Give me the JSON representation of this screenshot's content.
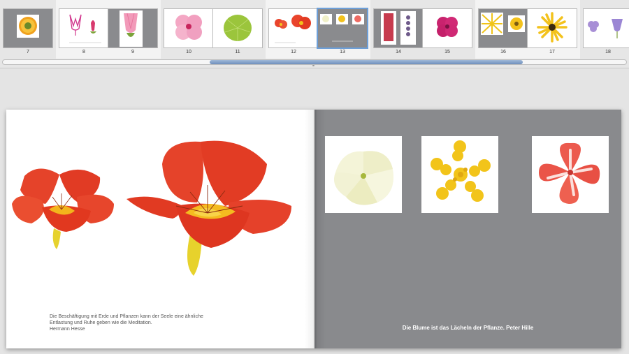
{
  "navigator": {
    "pages": [
      {
        "number": "7",
        "thumb": "sunflower-orange"
      },
      {
        "number": "8",
        "thumb": "tulip-outline"
      },
      {
        "number": "9",
        "thumb": "pink-bell-flower"
      },
      {
        "number": "10",
        "thumb": "pink-hibiscus"
      },
      {
        "number": "11",
        "thumb": "green-nasturtium-leaf"
      },
      {
        "number": "12",
        "thumb": "red-nasturtiums"
      },
      {
        "number": "13",
        "thumb": "three-flower-grid"
      },
      {
        "number": "14",
        "thumb": "red-and-purple-spikes"
      },
      {
        "number": "15",
        "thumb": "magenta-petunia"
      },
      {
        "number": "16",
        "thumb": "yellow-daisies"
      },
      {
        "number": "17",
        "thumb": "yellow-rudbeckia"
      },
      {
        "number": "18",
        "thumb": "purple-bellflowers"
      }
    ],
    "selected_page": "13",
    "scroll_position_fraction": 0.34,
    "visible_fraction": 0.5
  },
  "spread": {
    "left_page": {
      "quote_lines": [
        "Die Beschäftigung mit Erde und Pflanzen kann der Seele eine ähnliche",
        "Entlastung und Ruhe geben wie die Meditation.",
        "Hermann Hesse"
      ],
      "photos": [
        "red-nasturtium-small",
        "red-nasturtium-large"
      ]
    },
    "right_page": {
      "quote": "Die Blume ist das Lächeln der Pflanze. Peter Hille",
      "photos": [
        "white-petunia",
        "yellow-lantana",
        "red-white-impatiens"
      ]
    }
  },
  "colors": {
    "gray_page": "#898a8d",
    "selection": "#6d9fd8",
    "nasturtium_red": "#e8442c",
    "nasturtium_yellow": "#f2c21c"
  }
}
